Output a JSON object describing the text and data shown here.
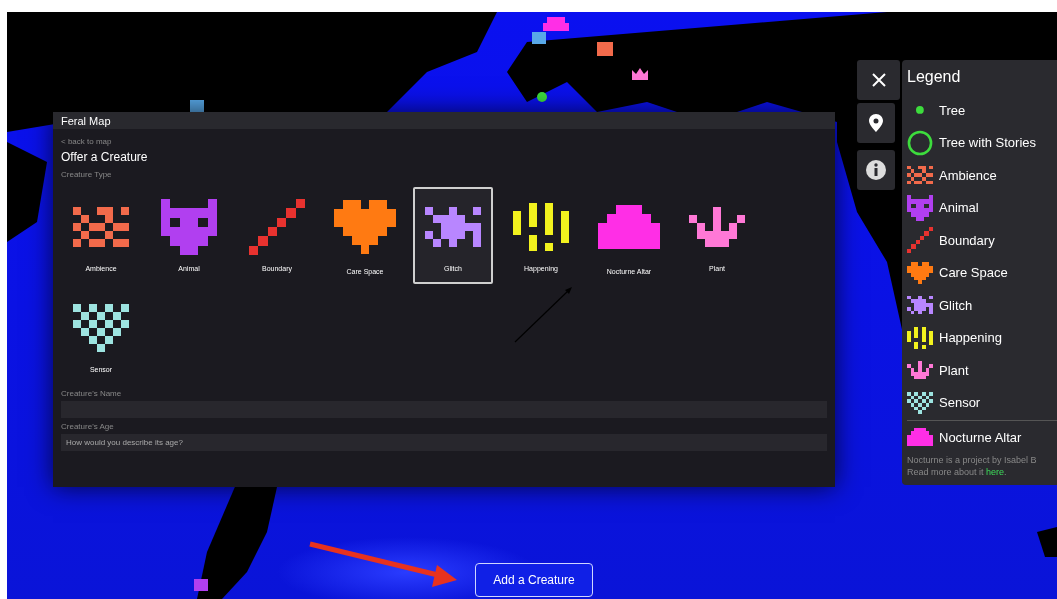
{
  "modal": {
    "title": "Feral Map",
    "back_link": "< back to map",
    "heading": "Offer a Creature",
    "type_label": "Creature Type",
    "creature_types": [
      {
        "kind": "ambience",
        "label": "Ambience",
        "color": "#f26a4b",
        "selected": false
      },
      {
        "kind": "animal",
        "label": "Animal",
        "color": "#b13ff0",
        "selected": false
      },
      {
        "kind": "boundary",
        "label": "Boundary",
        "color": "#e8322f",
        "selected": false
      },
      {
        "kind": "care",
        "label": "Care Space",
        "color": "#ff7a12",
        "selected": false
      },
      {
        "kind": "glitch",
        "label": "Glitch",
        "color": "#b886ff",
        "selected": true
      },
      {
        "kind": "happening",
        "label": "Happening",
        "color": "#f2f21e",
        "selected": false
      },
      {
        "kind": "altar",
        "label": "Nocturne Altar",
        "color": "#ff2ee6",
        "selected": false
      },
      {
        "kind": "plant",
        "label": "Plant",
        "color": "#ff78d6",
        "selected": false
      },
      {
        "kind": "sensor",
        "label": "Sensor",
        "color": "#9de3e0",
        "selected": false
      }
    ],
    "fields": [
      {
        "label": "Creature's Name"
      },
      {
        "label": "Creature's Age",
        "placeholder": "How would you describe its age?"
      }
    ]
  },
  "legend": {
    "title": "Legend",
    "items": [
      {
        "kind": "tree",
        "label": "Tree",
        "color": "#3ddc3d"
      },
      {
        "kind": "tree-stories",
        "label": "Tree with Stories",
        "color": "#3ddc3d"
      },
      {
        "kind": "ambience",
        "label": "Ambience",
        "color": "#f26a4b"
      },
      {
        "kind": "animal",
        "label": "Animal",
        "color": "#b13ff0"
      },
      {
        "kind": "boundary",
        "label": "Boundary",
        "color": "#e8322f"
      },
      {
        "kind": "care",
        "label": "Care Space",
        "color": "#ff7a12"
      },
      {
        "kind": "glitch",
        "label": "Glitch",
        "color": "#b886ff"
      },
      {
        "kind": "happening",
        "label": "Happening",
        "color": "#f2f21e"
      },
      {
        "kind": "plant",
        "label": "Plant",
        "color": "#ff78d6"
      },
      {
        "kind": "sensor",
        "label": "Sensor",
        "color": "#9de3e0"
      }
    ],
    "altar": {
      "kind": "altar",
      "label": "Nocturne Altar",
      "color": "#ff2ee6"
    },
    "note": "Nocturne is a project by Isabel B",
    "more": {
      "before": "Read more about it ",
      "link": "here",
      "after": "."
    }
  },
  "add_button": "Add a Creature"
}
